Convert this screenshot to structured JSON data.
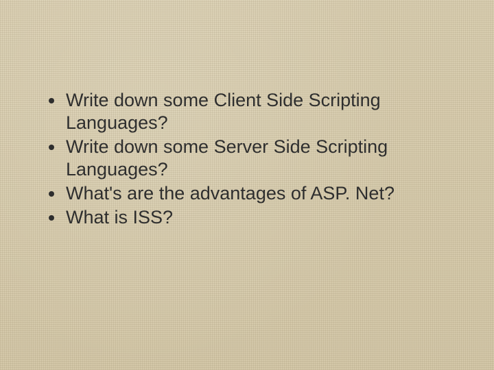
{
  "slide": {
    "bullets": [
      "Write down some Client Side Scripting Languages?",
      "Write down some Server Side Scripting Languages?",
      "What's are the advantages of ASP. Net?",
      "What is ISS?"
    ]
  }
}
